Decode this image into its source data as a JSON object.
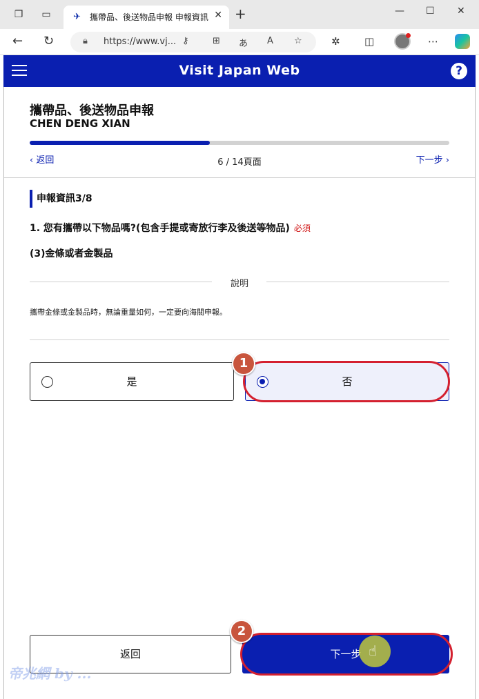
{
  "browser": {
    "tab_title": "攜帶品、後送物品申報 申報資訊",
    "tab_close": "✕",
    "new_tab": "+",
    "url": "https://www.vj...",
    "minimize": "—",
    "maximize": "☐",
    "close": "✕"
  },
  "app": {
    "title": "Visit Japan Web",
    "help_icon": "?",
    "brand_color": "#0a1fb0"
  },
  "form": {
    "heading": "攜帶品、後送物品申報",
    "name": "CHEN DENG XIAN",
    "progress": 0.43,
    "back_link": "返回",
    "page_count": "6 / 14頁面",
    "next_link": "下一步",
    "section_title": "申報資訊3/8",
    "question": "1. 您有攜帶以下物品嗎?(包含手提或寄放行李及後送等物品)",
    "required": "必須",
    "item": "(3)金條或者金製品",
    "explain_label": "說明",
    "explain_text": "攜帶金條或金製品時，無論重量如何，一定要向海關申報。",
    "options": [
      {
        "label": "是",
        "selected": false
      },
      {
        "label": "否",
        "selected": true
      }
    ],
    "back_button": "返回",
    "next_button": "下一步"
  },
  "annotations": {
    "step1": "1",
    "step2": "2",
    "highlight_color": "#d4202f"
  }
}
